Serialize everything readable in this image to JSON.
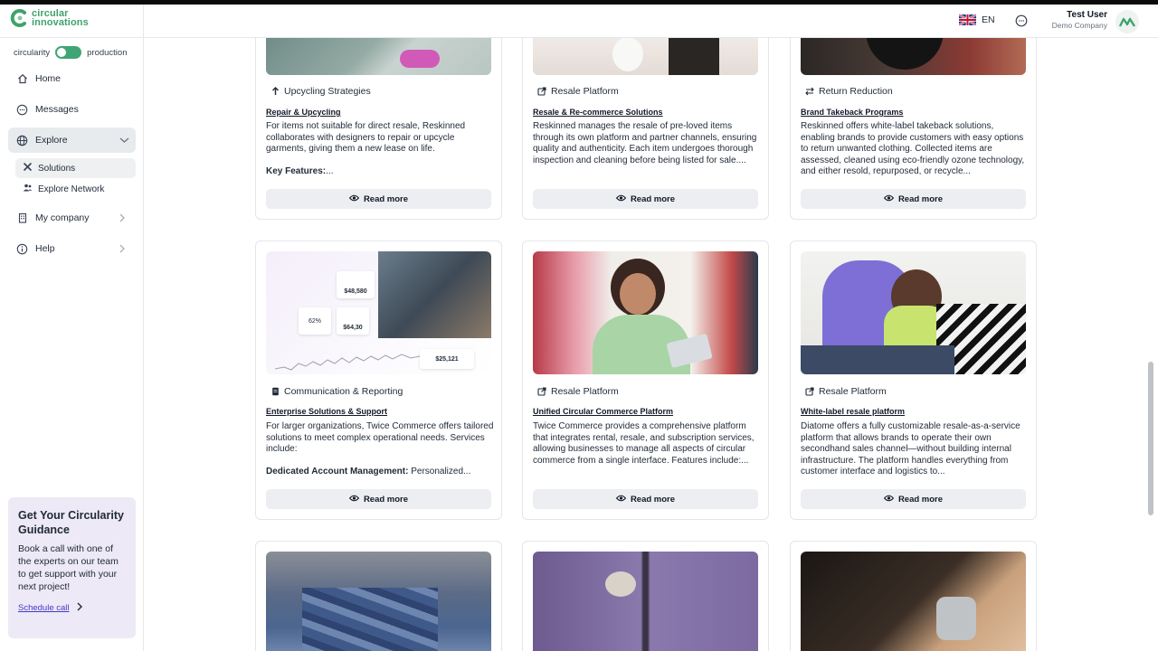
{
  "app": {
    "brand_line1": "circular",
    "brand_line2": "innovations"
  },
  "sidebar": {
    "toggle_left": "circularity",
    "toggle_right": "production",
    "items": [
      {
        "label": "Home"
      },
      {
        "label": "Messages"
      },
      {
        "label": "Explore"
      },
      {
        "label": "My company"
      },
      {
        "label": "Help"
      }
    ],
    "explore_sub": [
      {
        "label": "Solutions"
      },
      {
        "label": "Explore Network"
      }
    ],
    "guide": {
      "title": "Get Your Circularity Guidance",
      "body": "Book a call with one of the experts on our team to get support with your next project!",
      "link": "Schedule call"
    }
  },
  "header": {
    "language": "EN",
    "user_name": "Test User",
    "user_company": "Demo Company"
  },
  "cards": [
    {
      "tag": "Upcycling Strategies",
      "tag_icon": "arrow-up-icon",
      "title": "Repair & Upcycling",
      "desc": "For items not suitable for direct resale, Reskinned collaborates with designers to repair or upcycle garments, giving them a new lease on life.",
      "desc_bold": "Key Features:",
      "desc_tail": "...",
      "read_more": "Read more"
    },
    {
      "tag": "Resale Platform",
      "tag_icon": "external-link-icon",
      "title": "Resale & Re-commerce Solutions",
      "desc": "Reskinned manages the resale of pre-loved items through its own platform and partner channels, ensuring quality and authenticity. Each item undergoes thorough inspection and cleaning before being listed for sale....",
      "read_more": "Read more"
    },
    {
      "tag": "Return Reduction",
      "tag_icon": "swap-arrows-icon",
      "title": "Brand Takeback Programs",
      "desc": "Reskinned offers white-label takeback solutions, enabling brands to provide customers with easy options to return unwanted clothing. Collected items are assessed, cleaned using eco-friendly ozone technology, and either resold, repurposed, or recycle...",
      "read_more": "Read more"
    },
    {
      "tag": "Communication & Reporting",
      "tag_icon": "document-icon",
      "title": "Enterprise Solutions & Support",
      "desc": "For larger organizations, Twice Commerce offers tailored solutions to meet complex operational needs. Services include:",
      "desc_bold": "Dedicated Account Management:",
      "desc_tail": " Personalized...",
      "read_more": "Read more",
      "stats": [
        "$48,580",
        "62%",
        "$64,30",
        "$25,121"
      ]
    },
    {
      "tag": "Resale Platform",
      "tag_icon": "external-link-icon",
      "title": "Unified Circular Commerce Platform",
      "desc": "Twice Commerce provides a comprehensive platform that integrates rental, resale, and subscription services, allowing businesses to manage all aspects of circular commerce from a single interface. Features include:...",
      "read_more": "Read more"
    },
    {
      "tag": "Resale Platform",
      "tag_icon": "external-link-icon",
      "title": "White-label resale platform",
      "desc": "Diatome offers a fully customizable resale-as-a-service platform that allows brands to operate their own secondhand sales channel—without building internal infrastructure. The platform handles everything from customer interface and logistics to...",
      "read_more": "Read more"
    }
  ]
}
